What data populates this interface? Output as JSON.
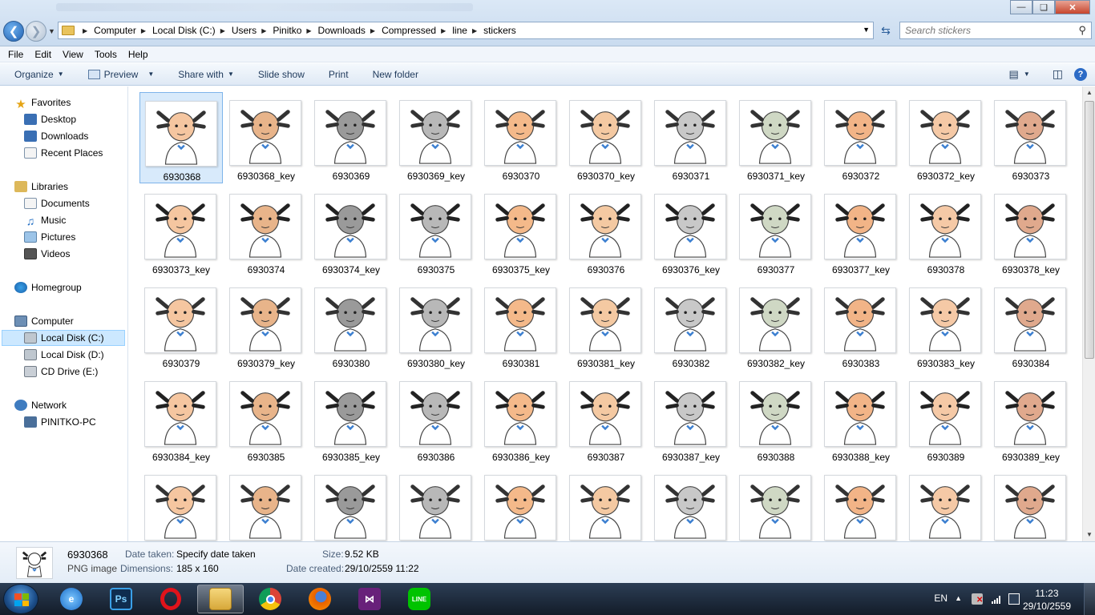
{
  "window": {
    "controls": [
      "minimize",
      "maximize",
      "close"
    ]
  },
  "address_bar": {
    "crumbs": [
      "Computer",
      "Local Disk (C:)",
      "Users",
      "Pinitko",
      "Downloads",
      "Compressed",
      "line",
      "stickers"
    ]
  },
  "search": {
    "placeholder": "Search stickers"
  },
  "menu": [
    "File",
    "Edit",
    "View",
    "Tools",
    "Help"
  ],
  "toolbar": {
    "organize": "Organize",
    "preview": "Preview",
    "share_with": "Share with",
    "slide_show": "Slide show",
    "print": "Print",
    "new_folder": "New folder"
  },
  "nav": {
    "favorites": "Favorites",
    "desktop": "Desktop",
    "downloads": "Downloads",
    "recent_places": "Recent Places",
    "libraries": "Libraries",
    "documents": "Documents",
    "music": "Music",
    "pictures": "Pictures",
    "videos": "Videos",
    "homegroup": "Homegroup",
    "computer": "Computer",
    "local_disk_c": "Local Disk (C:)",
    "local_disk_d": "Local Disk (D:)",
    "cd_drive_e": "CD Drive (E:)",
    "network": "Network",
    "pinitko_pc": "PINITKO-PC"
  },
  "files": [
    "6930368",
    "6930368_key",
    "6930369",
    "6930369_key",
    "6930370",
    "6930370_key",
    "6930371",
    "6930371_key",
    "6930372",
    "6930372_key",
    "6930373",
    "6930373_key",
    "6930374",
    "6930374_key",
    "6930375",
    "6930375_key",
    "6930376",
    "6930376_key",
    "6930377",
    "6930377_key",
    "6930378",
    "6930378_key",
    "6930379",
    "6930379_key",
    "6930380",
    "6930380_key",
    "6930381",
    "6930381_key",
    "6930382",
    "6930382_key",
    "6930383",
    "6930383_key",
    "6930384",
    "6930384_key",
    "6930385",
    "6930385_key",
    "6930386",
    "6930386_key",
    "6930387",
    "6930387_key",
    "6930388",
    "6930388_key",
    "6930389",
    "6930389_key",
    "",
    "",
    "",
    "",
    "",
    "",
    "",
    "",
    "",
    "",
    ""
  ],
  "selected_file": "6930368",
  "details": {
    "name": "6930368",
    "type": "PNG image",
    "date_taken_label": "Date taken:",
    "date_taken_value": "Specify date taken",
    "dimensions_label": "Dimensions:",
    "dimensions_value": "185 x 160",
    "size_label": "Size:",
    "size_value": "9.52 KB",
    "date_created_label": "Date created:",
    "date_created_value": "29/10/2559 11:22"
  },
  "taskbar": {
    "apps": [
      "ie-icon",
      "photoshop-icon",
      "opera-icon",
      "explorer-icon",
      "chrome-icon",
      "firefox-icon",
      "visual-studio-icon",
      "line-icon"
    ],
    "active_app": "explorer-icon",
    "language": "EN",
    "time": "11:23",
    "date": "29/10/2559"
  }
}
